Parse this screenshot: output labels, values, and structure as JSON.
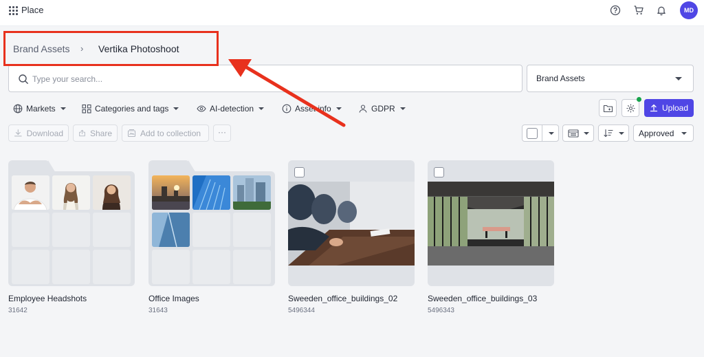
{
  "app": {
    "title": "Place",
    "avatar_initials": "MD"
  },
  "top_icons": [
    "help-icon",
    "cart-icon",
    "bell-icon"
  ],
  "breadcrumb": {
    "parent": "Brand Assets",
    "separator": "›",
    "current": "Vertika Photoshoot"
  },
  "search": {
    "placeholder": "Type your search...",
    "value": ""
  },
  "collection_select": {
    "value": "Brand Assets"
  },
  "filters": [
    {
      "label": "Markets",
      "icon": "globe-icon"
    },
    {
      "label": "Categories and tags",
      "icon": "tags-icon"
    },
    {
      "label": "AI-detection",
      "icon": "eye-icon"
    },
    {
      "label": "Asset info",
      "icon": "info-icon"
    },
    {
      "label": "GDPR",
      "icon": "person-icon"
    }
  ],
  "toolbar": {
    "upload_label": "Upload"
  },
  "actions": {
    "download": "Download",
    "share": "Share",
    "add_to_collection": "Add to collection",
    "more": "···"
  },
  "status_select": {
    "value": "Approved"
  },
  "items": [
    {
      "type": "folder",
      "name": "Employee Headshots",
      "id": "31642"
    },
    {
      "type": "folder",
      "name": "Office Images",
      "id": "31643"
    },
    {
      "type": "file",
      "name": "Sweeden_office_buildings_02",
      "id": "5496344"
    },
    {
      "type": "file",
      "name": "Sweeden_office_buildings_03",
      "id": "5496343"
    }
  ],
  "colors": {
    "accent": "#4f46e5",
    "annotation": "#e8311d",
    "status_dot": "#16a34a"
  }
}
